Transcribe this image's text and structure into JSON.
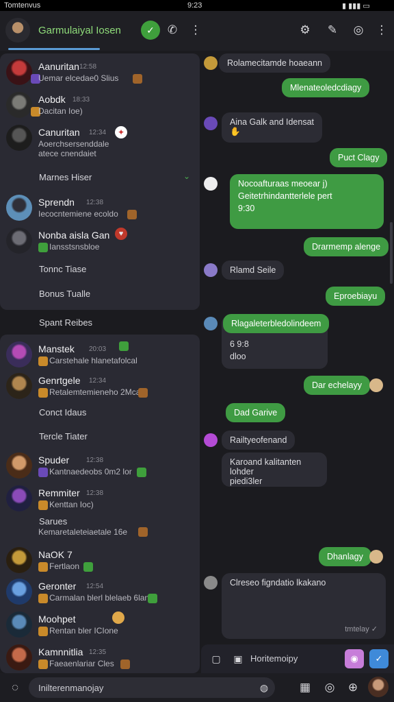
{
  "status": {
    "left": "Tomtenvus",
    "time": "9:23"
  },
  "header": {
    "title": "Garmulaiyal Iosen"
  },
  "contacts_top": [
    {
      "name": "Aanuritan",
      "time": "12:58",
      "preview": "Uemar elcedae0 Slius"
    },
    {
      "name": "Aobdk",
      "time": "18:33",
      "preview": "Dacitan Ioe)"
    },
    {
      "name": "Canuritan",
      "time": "12:34",
      "preview": "Aoerchsersenddale",
      "preview2": "atece cnendaiet"
    }
  ],
  "label_marnes": "Marnes Hiser",
  "contacts_mid": [
    {
      "name": "Sprendn",
      "time": "12:38",
      "preview": "Iecocntemiene ecoldo"
    },
    {
      "name": "Nonba aisla Gan",
      "time": "",
      "preview": "Iansstsnsbloe"
    }
  ],
  "label_tonnc": "Tonnc Tiase",
  "label_bonus": "Bonus Tualle",
  "label_spant": "Spant Reibes",
  "contacts_bottom": [
    {
      "name": "Manstek",
      "time": "20:03",
      "preview": "Carstehale hlanetafolcal"
    },
    {
      "name": "Genrtgele",
      "time": "12:34",
      "preview": "Retalemtemieneho 2Mcar"
    }
  ],
  "label_conct": "Conct Idaus",
  "label_tercle": "Tercle Tiater",
  "contacts_bottom2": [
    {
      "name": "Spuder",
      "time": "12:38",
      "preview": "Kantnaedeobs 0m2 lor"
    },
    {
      "name": "Remmiter",
      "time": "12:38",
      "preview": "Kenttan Ioc)"
    }
  ],
  "label_sarues": "Sarues",
  "sarues_preview": "Kemaretaleteiaetale 16e",
  "contacts_bottom3": [
    {
      "name": "NaOK 7",
      "time": "",
      "preview": "Fertlaon"
    },
    {
      "name": "Geronter",
      "time": "12:54",
      "preview": "Carmalan blerl blelaeb 6lan"
    },
    {
      "name": "Moohpet",
      "time": "",
      "preview": "Rentan bler ICIone"
    },
    {
      "name": "Kamnnitlia",
      "time": "12:35",
      "preview": "Faeaenlariar Cles"
    }
  ],
  "messages": [
    {
      "dir": "in",
      "text": "Rolamecitamde hoaeann"
    },
    {
      "dir": "out",
      "text": "Mlenateoledcdiagy"
    },
    {
      "dir": "in",
      "text": "Aina Galk and Idensat"
    },
    {
      "dir": "out",
      "text": "Puct Clagy"
    },
    {
      "dir": "out",
      "text": "Nocoafturaas meoear j)",
      "text2": "Geitetrhindantterlele pert",
      "text3": "9:30"
    },
    {
      "dir": "out",
      "text": "Drarmemp alenge"
    },
    {
      "dir": "in",
      "text": "Rlamd Seile"
    },
    {
      "dir": "out",
      "text": "Eproebiayu"
    },
    {
      "dir": "out",
      "text": "Rlagaleterbledolindeem"
    },
    {
      "dir": "in",
      "text": "6 9:8",
      "text2": "dloo"
    },
    {
      "dir": "out",
      "text": "Dar echelayy"
    },
    {
      "dir": "out",
      "text": "Dad Garive"
    },
    {
      "dir": "in",
      "text": "Railtyeofenand"
    },
    {
      "dir": "in",
      "text": "Karoand kalitanten lohder",
      "text2": "piedi3ler"
    },
    {
      "dir": "out",
      "text": "Dhanlagy"
    },
    {
      "dir": "in",
      "text": "Clreseo figndatio lkakano",
      "time": "tmtelay"
    }
  ],
  "composer": {
    "placeholder": "Horitemoipy"
  },
  "bottom": {
    "search": "Inilterenmanojay"
  },
  "icons": [
    "settings-icon",
    "edit-icon",
    "info-icon",
    "search-icon",
    "mic-icon"
  ]
}
